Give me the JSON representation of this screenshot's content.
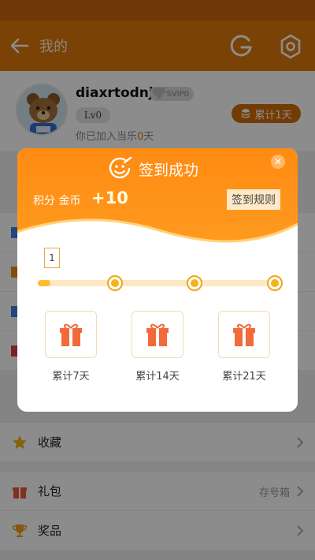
{
  "header": {
    "title": "我的",
    "back_icon": "back-arrow-icon",
    "account_icon": "g-account-icon",
    "settings_icon": "gear-icon"
  },
  "profile": {
    "username": "diaxrtodnj0",
    "vip_badge": "SVIP0",
    "level": "Lv0",
    "joined_prefix": "你已加入当乐",
    "joined_days": "0",
    "joined_suffix": "天",
    "cumulative_button": "累计1天"
  },
  "menu": {
    "favorites": "收藏",
    "gifts": "礼包",
    "gifts_right": "存号箱",
    "prizes": "奖品"
  },
  "modal": {
    "title": "签到成功",
    "points_label": "积分 金币",
    "points_value": "+10",
    "rules_button": "签到规则",
    "progress_day": "1",
    "progress_fraction": 0.05,
    "rewards": [
      {
        "label": "累计7天"
      },
      {
        "label": "累计14天"
      },
      {
        "label": "累计21天"
      }
    ]
  },
  "colors": {
    "header": "#e0780b",
    "accent": "#ff8a12",
    "status_bar": "#6d3706"
  }
}
